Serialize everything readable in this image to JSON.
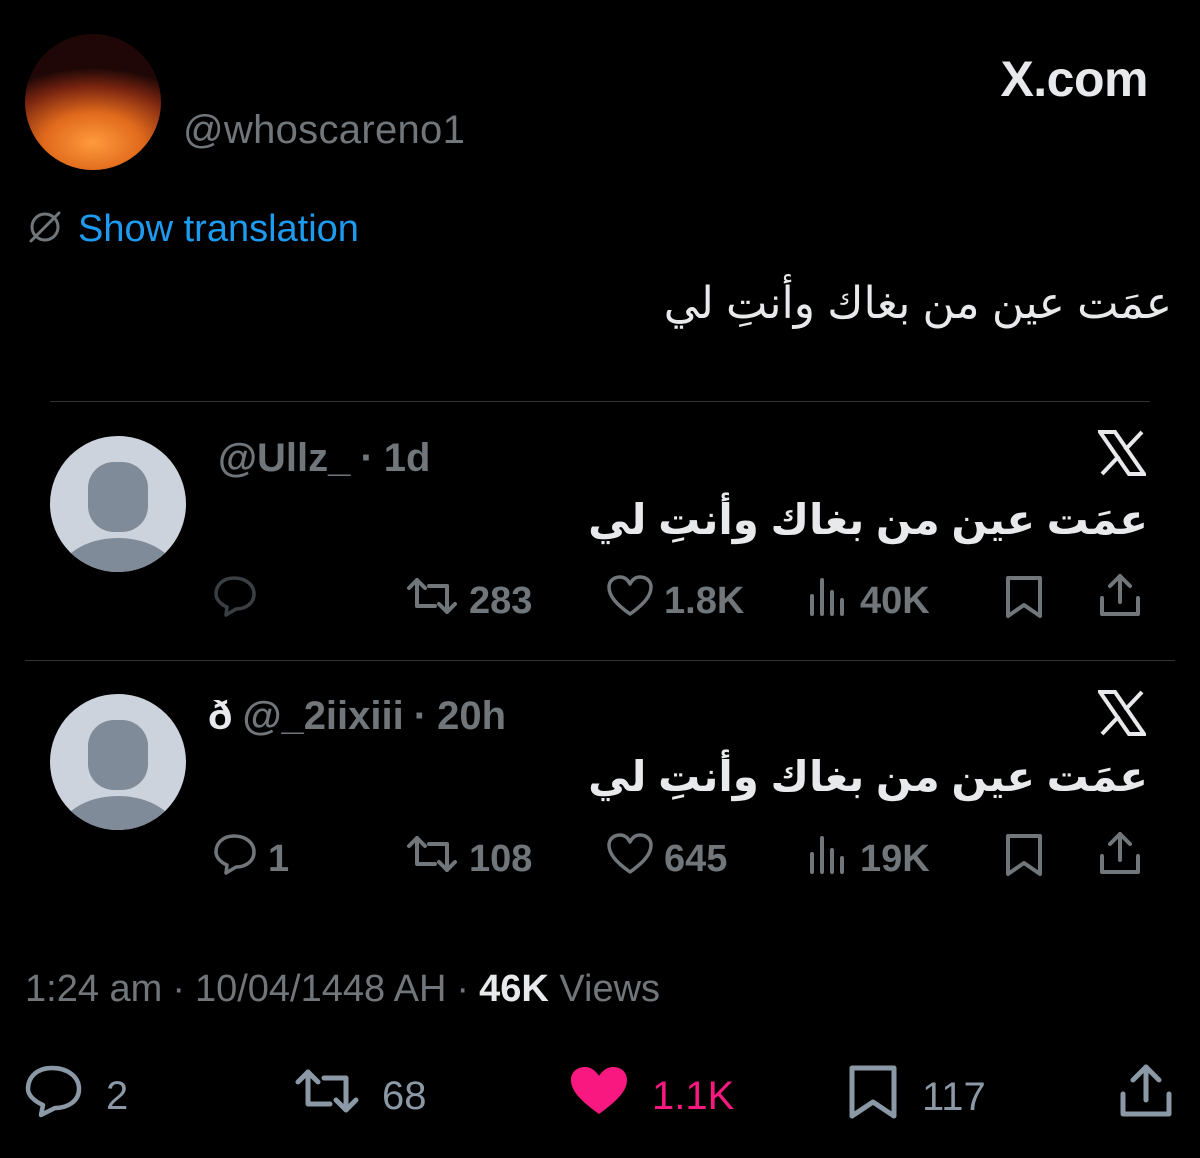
{
  "header": {
    "handle": "@whoscareno1",
    "brand": "X.com"
  },
  "translation": {
    "label": "Show translation"
  },
  "tweet": {
    "text": "عمَت عين من بغاك وأنتِ لي"
  },
  "quotes": [
    {
      "name": "",
      "handle": "@Ullz_",
      "time": "1d",
      "text": "عمَت عين من بغاك وأنتِ لي",
      "replies": "",
      "retweets": "283",
      "likes": "1.8K",
      "views": "40K"
    },
    {
      "name": "ð",
      "handle": "@_2iixiii",
      "time": "20h",
      "text": "عمَت عين من بغاك وأنتِ لي",
      "replies": "1",
      "retweets": "108",
      "likes": "645",
      "views": "19K"
    }
  ],
  "meta": {
    "time": "1:24 am",
    "date": "10/04/1448 AH",
    "views_count": "46K",
    "views_label": "Views",
    "sep": "·"
  },
  "stats": {
    "replies": "2",
    "retweets": "68",
    "likes": "1.1K",
    "bookmarks": "117"
  },
  "colors": {
    "background": "#000000",
    "link": "#1d9bf0",
    "like_active": "#f91880",
    "muted": "#71767b"
  },
  "icons": [
    "x-logo-icon",
    "translate-icon",
    "reply-icon",
    "retweet-icon",
    "like-icon",
    "views-icon",
    "bookmark-icon",
    "share-icon",
    "default-avatar-icon"
  ]
}
